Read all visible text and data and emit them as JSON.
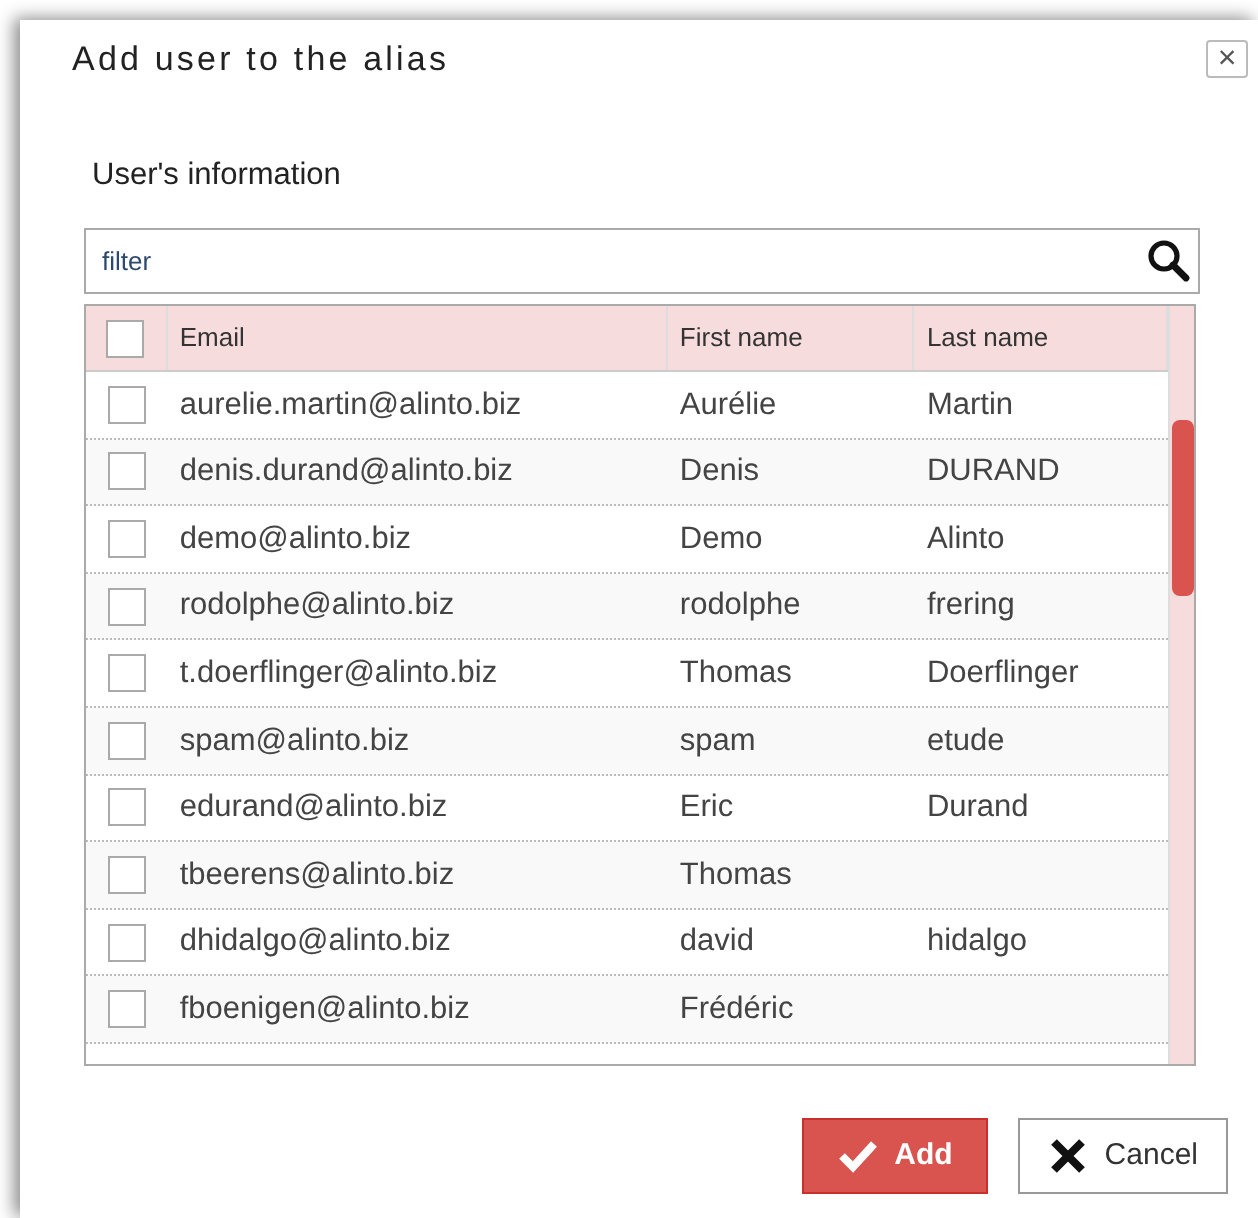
{
  "dialog": {
    "title": "Add user to the alias",
    "close": "×"
  },
  "section_title": "User's information",
  "filter": {
    "placeholder": "filter"
  },
  "table": {
    "select_all_checked": false,
    "columns": [
      "Email",
      "First name",
      "Last name"
    ],
    "rows": [
      {
        "checked": false,
        "cells": [
          "aurelie.martin@alinto.biz",
          "Aurélie",
          "Martin"
        ]
      },
      {
        "checked": false,
        "cells": [
          "denis.durand@alinto.biz",
          "Denis",
          "DURAND"
        ]
      },
      {
        "checked": false,
        "cells": [
          "demo@alinto.biz",
          "Demo",
          "Alinto"
        ]
      },
      {
        "checked": false,
        "cells": [
          "rodolphe@alinto.biz",
          "rodolphe",
          "frering"
        ]
      },
      {
        "checked": false,
        "cells": [
          "t.doerflinger@alinto.biz",
          "Thomas",
          "Doerflinger"
        ]
      },
      {
        "checked": false,
        "cells": [
          "spam@alinto.biz",
          "spam",
          "etude"
        ]
      },
      {
        "checked": false,
        "cells": [
          "edurand@alinto.biz",
          "Eric",
          "Durand"
        ]
      },
      {
        "checked": false,
        "cells": [
          "tbeerens@alinto.biz",
          "Thomas",
          ""
        ]
      },
      {
        "checked": false,
        "cells": [
          "dhidalgo@alinto.biz",
          "david",
          "hidalgo"
        ]
      },
      {
        "checked": false,
        "cells": [
          "fboenigen@alinto.biz",
          "Frédéric",
          ""
        ]
      }
    ]
  },
  "buttons": [
    {
      "kind": "primary",
      "label": "Add"
    },
    {
      "kind": "cancel",
      "label": "Cancel"
    }
  ]
}
